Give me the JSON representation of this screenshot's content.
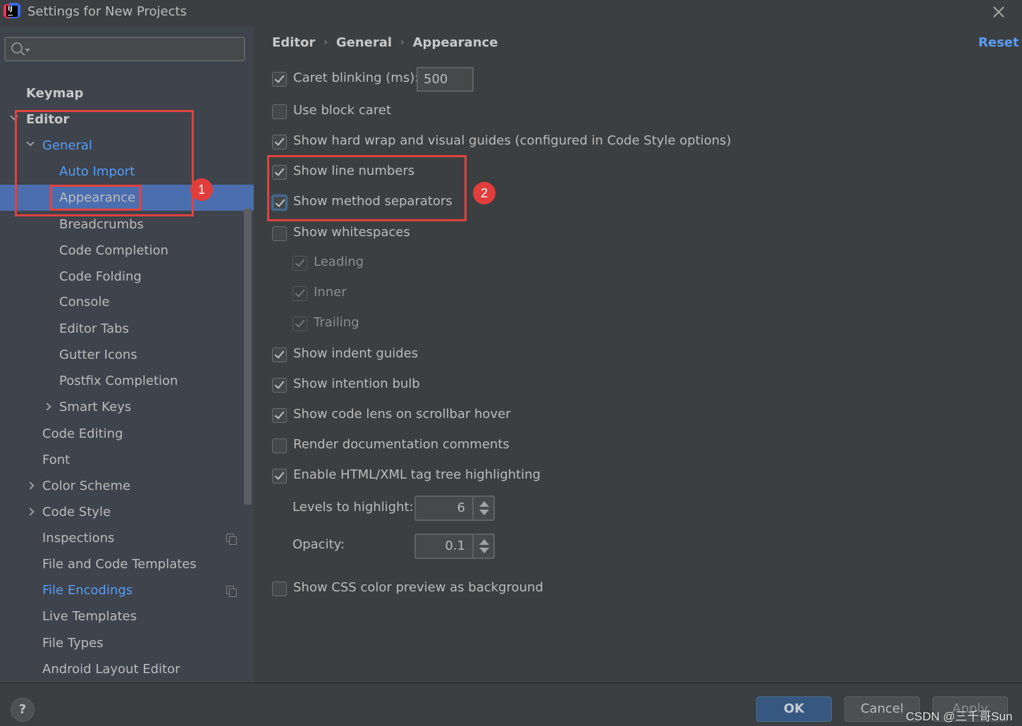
{
  "window": {
    "title": "Settings for New Projects",
    "close_icon": "close-icon",
    "app_icon": "intellij-idea-icon",
    "app_icon_text": "IJ"
  },
  "sidebar": {
    "search": {
      "value": "",
      "placeholder": "",
      "icon": "search-icon"
    },
    "items": [
      {
        "label": "Keymap",
        "style": "bold",
        "indent": 0,
        "expander": "none"
      },
      {
        "label": "Editor",
        "style": "bold",
        "indent": 0,
        "expander": "down"
      },
      {
        "label": "General",
        "style": "link",
        "indent": 1,
        "expander": "down"
      },
      {
        "label": "Auto Import",
        "style": "link",
        "indent": 2,
        "expander": "none"
      },
      {
        "label": "Appearance",
        "style": "selected",
        "indent": 2,
        "expander": "none"
      },
      {
        "label": "Breadcrumbs",
        "style": "normal",
        "indent": 2,
        "expander": "none"
      },
      {
        "label": "Code Completion",
        "style": "normal",
        "indent": 2,
        "expander": "none"
      },
      {
        "label": "Code Folding",
        "style": "normal",
        "indent": 2,
        "expander": "none"
      },
      {
        "label": "Console",
        "style": "normal",
        "indent": 2,
        "expander": "none"
      },
      {
        "label": "Editor Tabs",
        "style": "normal",
        "indent": 2,
        "expander": "none"
      },
      {
        "label": "Gutter Icons",
        "style": "normal",
        "indent": 2,
        "expander": "none"
      },
      {
        "label": "Postfix Completion",
        "style": "normal",
        "indent": 2,
        "expander": "none"
      },
      {
        "label": "Smart Keys",
        "style": "normal",
        "indent": 2,
        "expander": "right"
      },
      {
        "label": "Code Editing",
        "style": "normal",
        "indent": 1,
        "expander": "none"
      },
      {
        "label": "Font",
        "style": "normal",
        "indent": 1,
        "expander": "none"
      },
      {
        "label": "Color Scheme",
        "style": "normal",
        "indent": 1,
        "expander": "right"
      },
      {
        "label": "Code Style",
        "style": "normal",
        "indent": 1,
        "expander": "right"
      },
      {
        "label": "Inspections",
        "style": "normal",
        "indent": 1,
        "expander": "none",
        "badge_icon": "project-copy-icon"
      },
      {
        "label": "File and Code Templates",
        "style": "normal",
        "indent": 1,
        "expander": "none"
      },
      {
        "label": "File Encodings",
        "style": "link",
        "indent": 1,
        "expander": "none",
        "badge_icon": "project-copy-icon"
      },
      {
        "label": "Live Templates",
        "style": "normal",
        "indent": 1,
        "expander": "none"
      },
      {
        "label": "File Types",
        "style": "normal",
        "indent": 1,
        "expander": "none"
      },
      {
        "label": "Android Layout Editor",
        "style": "normal",
        "indent": 1,
        "expander": "none"
      }
    ]
  },
  "main": {
    "breadcrumb": [
      "Editor",
      "General",
      "Appearance"
    ],
    "breadcrumb_separator": "›",
    "reset_label": "Reset",
    "caret_blinking_value": "500",
    "options": [
      {
        "label": "Caret blinking (ms):",
        "checked": true,
        "indent": 0,
        "disabled": false
      },
      {
        "label": "Use block caret",
        "checked": false,
        "indent": 0,
        "disabled": false
      },
      {
        "label": "Show hard wrap and visual guides (configured in Code Style options)",
        "checked": true,
        "indent": 0,
        "disabled": false
      },
      {
        "label": "Show line numbers",
        "checked": true,
        "indent": 0,
        "disabled": false
      },
      {
        "label": "Show method separators",
        "checked": true,
        "indent": 0,
        "disabled": false,
        "focused": true
      },
      {
        "label": "Show whitespaces",
        "checked": false,
        "indent": 0,
        "disabled": false
      },
      {
        "label": "Leading",
        "checked": true,
        "indent": 1,
        "disabled": true
      },
      {
        "label": "Inner",
        "checked": true,
        "indent": 1,
        "disabled": true
      },
      {
        "label": "Trailing",
        "checked": true,
        "indent": 1,
        "disabled": true
      },
      {
        "label": "Show indent guides",
        "checked": true,
        "indent": 0,
        "disabled": false
      },
      {
        "label": "Show intention bulb",
        "checked": true,
        "indent": 0,
        "disabled": false
      },
      {
        "label": "Show code lens on scrollbar hover",
        "checked": true,
        "indent": 0,
        "disabled": false
      },
      {
        "label": "Render documentation comments",
        "checked": false,
        "indent": 0,
        "disabled": false
      },
      {
        "label": "Enable HTML/XML tag tree highlighting",
        "checked": true,
        "indent": 0,
        "disabled": false
      }
    ],
    "levels_label": "Levels to highlight:",
    "levels_value": "6",
    "opacity_label": "Opacity:",
    "opacity_value": "0.1",
    "css_preview": {
      "label": "Show CSS color preview as background",
      "checked": false
    }
  },
  "annotations": {
    "badge1": "1",
    "badge2": "2",
    "color": "#e0423e"
  },
  "footer": {
    "help_label": "?",
    "ok_label": "OK",
    "cancel_label": "Cancel",
    "apply_label": "Apply",
    "watermark": "CSDN @三千哥Sun"
  },
  "colors": {
    "accent": "#589df6",
    "selection": "#4b6eaf",
    "ok_button": "#365880",
    "sidebar_bg": "#3e434c",
    "panel_bg": "#3c3f41"
  }
}
